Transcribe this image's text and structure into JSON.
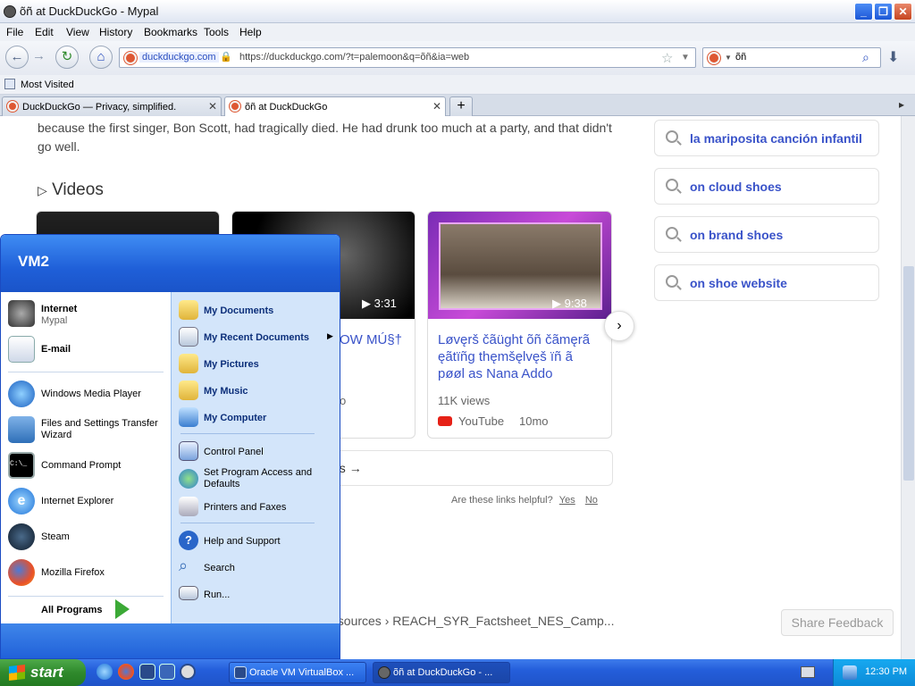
{
  "window": {
    "title": "õñ at DuckDuckGo - Mypal"
  },
  "menu": [
    "File",
    "Edit",
    "View",
    "History",
    "Bookmarks",
    "Tools",
    "Help"
  ],
  "nav": {
    "site_label": "duckduckgo.com",
    "url": "https://duckduckgo.com/?t=palemoon&q=õñ&ia=web",
    "search_value": "õñ"
  },
  "bookmarks": {
    "most_visited": "Most Visited"
  },
  "tabs": [
    {
      "label": "DuckDuckGo — Privacy, simplified."
    },
    {
      "label": "õñ at DuckDuckGo"
    }
  ],
  "content": {
    "paragraph": "because the first singer, Bon Scott, had tragically died. He had drunk too much at a party, and that didn't go well.",
    "videos_heading": "Videos",
    "videos": [
      {
        "duration": "",
        "title": "",
        "views": "",
        "source": "",
        "age": ""
      },
      {
        "duration": "3:31",
        "title": "OW MÚ§†",
        "views": "",
        "source": "",
        "age": "o"
      },
      {
        "duration": "9:38",
        "title": "Løvęrš čãüght õñ čãmęrã ęãtïñg thęmšęlvęš ïñ ã pøøl as Nana Addo",
        "views": "11K views",
        "source": "YouTube",
        "age": "10mo"
      }
    ],
    "more_videos_fragment": "os",
    "helpful_question": "Are these links helpful?",
    "helpful_yes": "Yes",
    "helpful_no": "No",
    "breadcrumb": "esources › REACH_SYR_Factsheet_NES_Camp...",
    "share_feedback": "Share Feedback",
    "suggestions": [
      "la mariposita canción infantil",
      "on cloud shoes",
      "on brand shoes",
      "on shoe website"
    ]
  },
  "start_menu": {
    "user": "VM2",
    "pinned": [
      {
        "title": "Internet",
        "sub": "Mypal"
      },
      {
        "title": "E-mail",
        "sub": ""
      }
    ],
    "recent": [
      "Windows Media Player",
      "Files and Settings Transfer Wizard",
      "Command Prompt",
      "Internet Explorer",
      "Steam",
      "Mozilla Firefox"
    ],
    "all_programs": "All Programs",
    "places": [
      "My Documents",
      "My Recent Documents",
      "My Pictures",
      "My Music",
      "My Computer"
    ],
    "system": [
      "Control Panel",
      "Set Program Access and Defaults",
      "Printers and Faxes"
    ],
    "help": [
      "Help and Support",
      "Search",
      "Run..."
    ]
  },
  "taskbar": {
    "start": "start",
    "tasks": [
      "Oracle VM VirtualBox ...",
      "õñ at DuckDuckGo - ..."
    ],
    "clock": "12:30 PM"
  },
  "colors": {
    "accent": "#3a53c9",
    "ddg": "#de5833",
    "xp_blue": "#245edb",
    "start_green": "#2f8a2c"
  }
}
